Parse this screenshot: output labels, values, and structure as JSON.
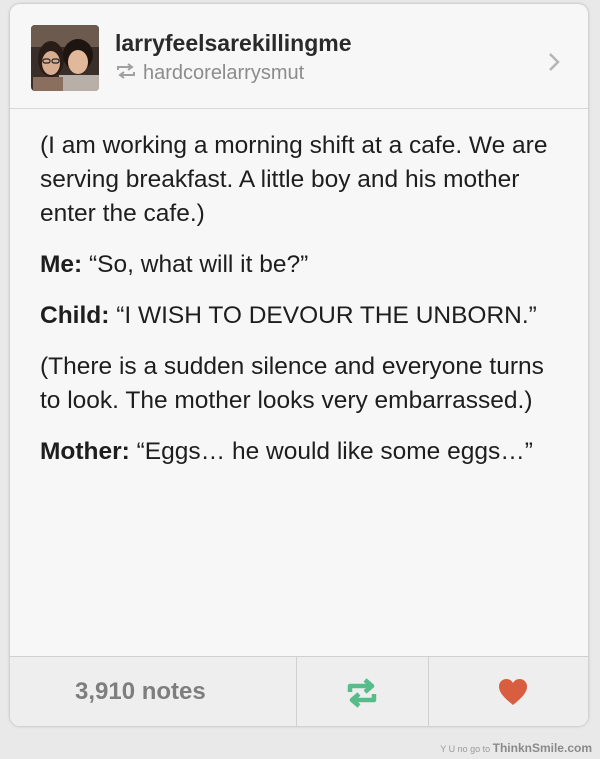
{
  "post": {
    "username": "larryfeelsarekillingme",
    "reblogged_from": "hardcorelarrysmut",
    "body": {
      "intro": "(I am working a morning shift at a cafe. We are serving breakfast. A little boy and his mother enter the cafe.)",
      "line1_speaker": "Me:",
      "line1_text": "“So, what will it be?”",
      "line2_speaker": "Child:",
      "line2_text": "“I WISH TO DEVOUR THE UNBORN.”",
      "narration": "(There is a sudden silence and everyone turns to look. The mother looks very embarrassed.)",
      "line3_speaker": "Mother:",
      "line3_text": "“Eggs… he would like some eggs…”"
    }
  },
  "footer": {
    "notes": "3,910 notes",
    "reblog_color": "#56bc8a",
    "like_color": "#d95e40"
  },
  "watermark": {
    "prefix": "Y U no go to",
    "brand": "ThinknSmile.com"
  },
  "icons": {
    "reblog_small": "reblog-icon",
    "chevron": "chevron-right-icon",
    "reblog_button": "reblog-icon",
    "like_button": "heart-icon"
  }
}
